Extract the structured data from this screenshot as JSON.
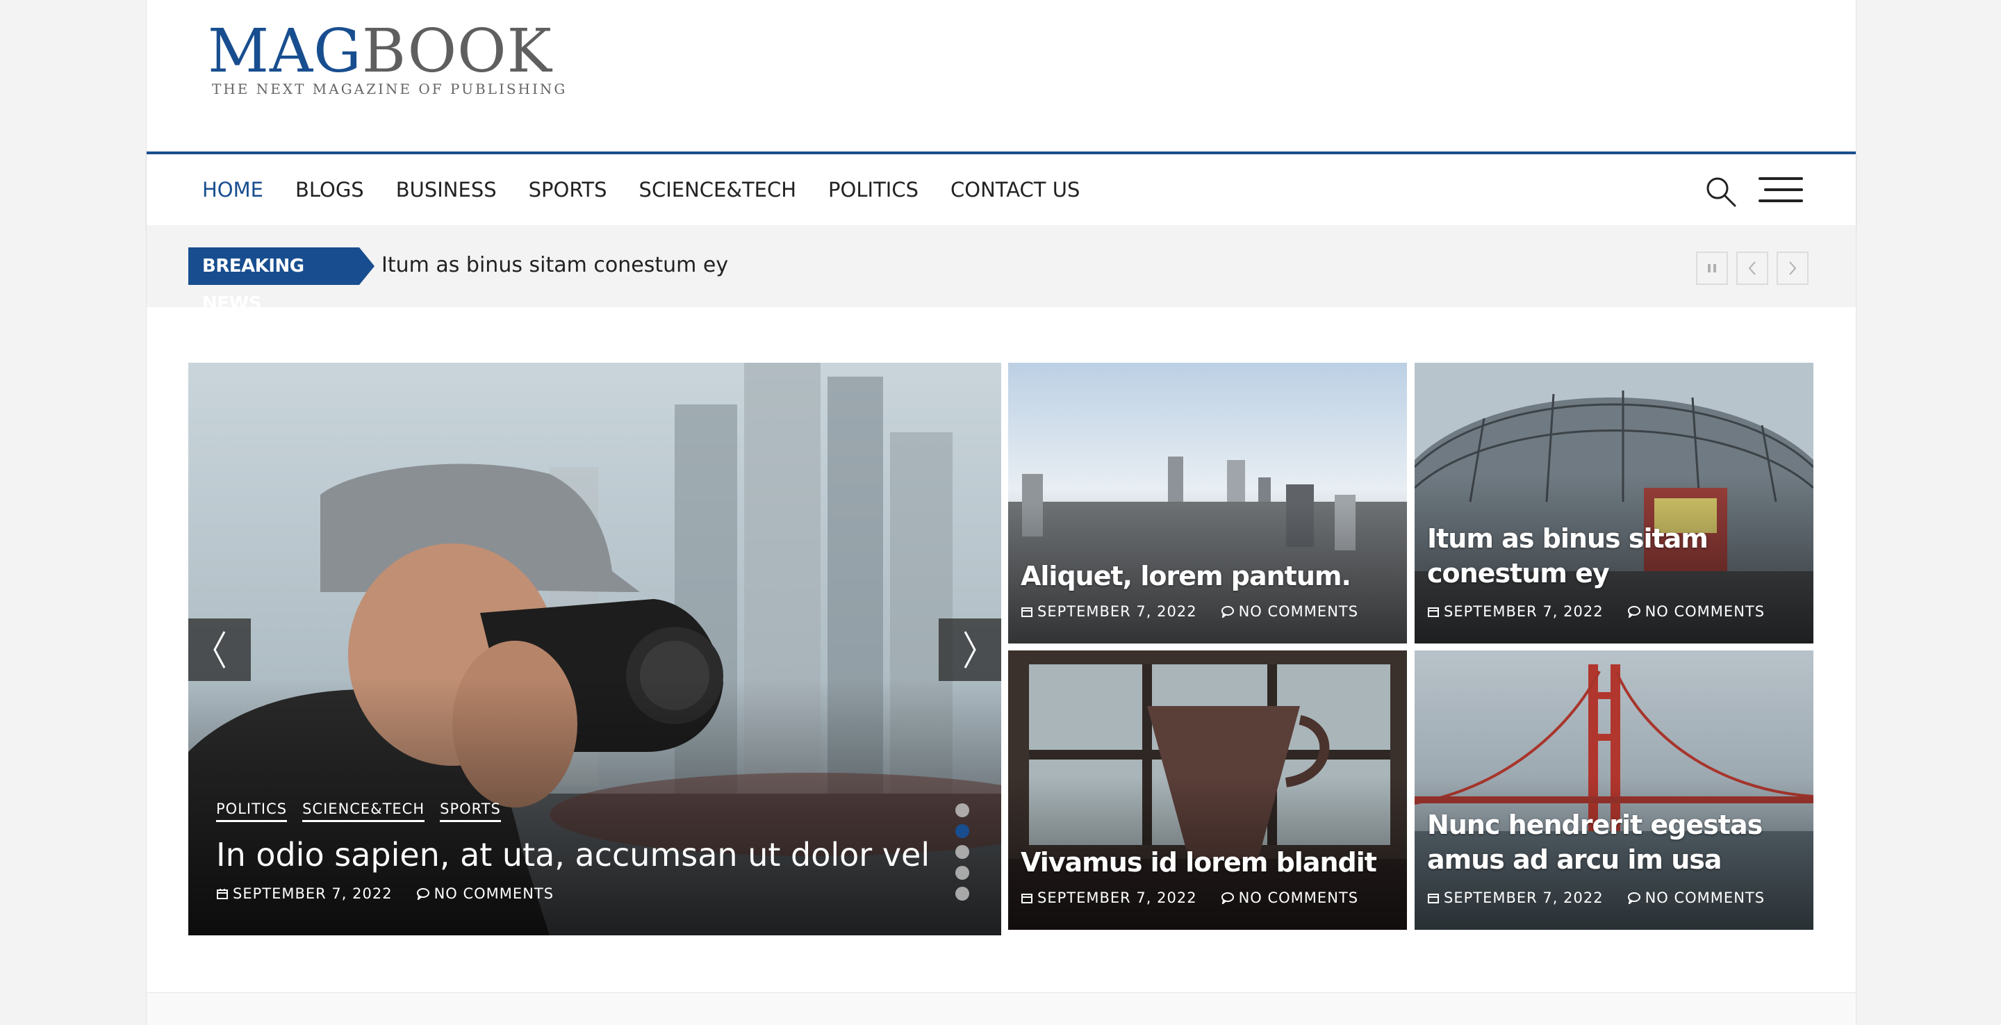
{
  "logo": {
    "mag": "MAG",
    "book": "BOOK",
    "tagline": "THE NEXT MAGAZINE OF PUBLISHING"
  },
  "nav": {
    "items": [
      {
        "label": "HOME",
        "active": true
      },
      {
        "label": "BLOGS"
      },
      {
        "label": "BUSINESS"
      },
      {
        "label": "SPORTS"
      },
      {
        "label": "SCIENCE&TECH"
      },
      {
        "label": "POLITICS"
      },
      {
        "label": "CONTACT US"
      }
    ],
    "search_icon": "search-icon",
    "menu_icon": "hamburger-menu-icon"
  },
  "breaking": {
    "label": "BREAKING NEWS",
    "headline": "Itum as binus sitam conestum ey",
    "controls": [
      "pause-icon",
      "chevron-left-icon",
      "chevron-right-icon"
    ]
  },
  "slider": {
    "categories": [
      "POLITICS",
      "SCIENCE&TECH",
      "SPORTS"
    ],
    "title": "In odio sapien, at uta, accumsan ut dolor vel",
    "date": "SEPTEMBER 7, 2022",
    "comments": "NO COMMENTS",
    "dots": 5,
    "active_dot": 2
  },
  "grid": [
    {
      "title": "Aliquet, lorem pantum.",
      "date": "SEPTEMBER 7, 2022",
      "comments": "NO COMMENTS"
    },
    {
      "title": "Itum as binus sitam conestum ey",
      "date": "SEPTEMBER 7, 2022",
      "comments": "NO COMMENTS"
    },
    {
      "title": "Vivamus id lorem blandit",
      "date": "SEPTEMBER 7, 2022",
      "comments": "NO COMMENTS"
    },
    {
      "title": "Nunc hendrerit egestas amus ad arcu im usa",
      "date": "SEPTEMBER 7, 2022",
      "comments": "NO COMMENTS"
    }
  ],
  "colors": {
    "accent": "#184e8f",
    "text": "#222222",
    "breaking_bg": "#f3f3f3"
  }
}
